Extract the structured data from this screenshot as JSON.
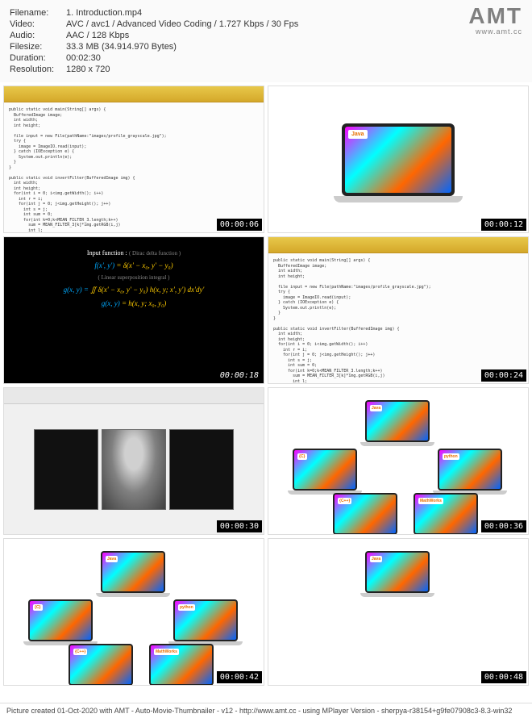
{
  "meta": {
    "filename_label": "Filename:",
    "filename_value": "1. Introduction.mp4",
    "video_label": "Video:",
    "video_value": "AVC / avc1 / Advanced Video Coding / 1.727 Kbps / 30 Fps",
    "audio_label": "Audio:",
    "audio_value": "AAC / 128 Kbps",
    "filesize_label": "Filesize:",
    "filesize_value": "33.3 MB (34.914.970 Bytes)",
    "duration_label": "Duration:",
    "duration_value": "00:02:30",
    "resolution_label": "Resolution:",
    "resolution_value": "1280 x 720"
  },
  "logo": {
    "text": "AMT",
    "url": "www.amt.cc"
  },
  "thumbs": [
    {
      "ts": "00:00:06"
    },
    {
      "ts": "00:00:12"
    },
    {
      "ts": "00:00:18"
    },
    {
      "ts": "00:00:24"
    },
    {
      "ts": "00:00:30"
    },
    {
      "ts": "00:00:36"
    },
    {
      "ts": "00:00:42"
    },
    {
      "ts": "00:00:48"
    }
  ],
  "code_sample": "public static void main(String[] args) {\n  BufferedImage image;\n  int width;\n  int height;\n\n  file input = new File(pathName:\"images/profile_grayscale.jpg\");\n  try {\n    image = ImageIO.read(input);\n  } catch (IOException e) {\n    System.out.println(e);\n  }\n}\n\npublic static void invertFilter(BufferedImage img) {\n  int width;\n  int height;\n  for(int i = 0; i<img.getWidth(); i++)\n    int r = i;\n    for(int j = 0; j<img.getHeight(); j++)\n      int s = j;\n      int sum = 0;\n      for(int k=0;k<MEAN_FILTER_3.length;k++)\n        sum = MEAN_FILTER_3[k]*img.getRGB(i,j)\n        int l;",
  "formulas": {
    "input_label": "Input function :",
    "dirac_comment": "( Dirac delta function )",
    "line1_lhs": "f(x', y')",
    "line1_rhs": "δ(x' − x₀, y' − y₀)",
    "integral_comment": "( Linear superposition integral )",
    "line2_lhs": "g(x, y) = ",
    "line2_rhs": "∬ δ(x' − x₀, y' − y₀) h(x, y; x', y') dx'dy'",
    "line3_lhs": "g(x, y)",
    "line3_rhs": "h(x, y; x₀, y₀)"
  },
  "badges": {
    "java": "Java",
    "c": "{C}",
    "cpp": "{C++}",
    "python": "python",
    "matlab": "MathWorks"
  },
  "footer_text": "Picture created 01-Oct-2020 with AMT - Auto-Movie-Thumbnailer - v12 - http://www.amt.cc - using MPlayer Version - sherpya-r38154+g9fe07908c3-8.3-win32"
}
